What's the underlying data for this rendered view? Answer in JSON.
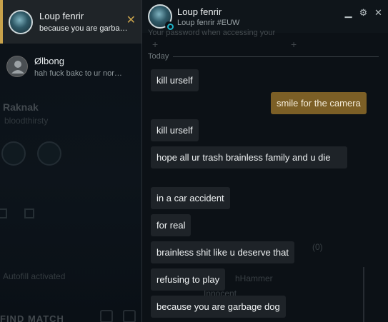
{
  "conversations": [
    {
      "name": "Loup fenrir",
      "preview": "because you are garbage dog",
      "active": true
    },
    {
      "name": "Ølbong",
      "preview": "hah fuck bakc to ur normal",
      "active": false
    }
  ],
  "background_client": {
    "summoner_name": "Raknak",
    "status": "bloodthirsty",
    "autofill_text": "Autofill activated",
    "match_button": "FIND MATCH"
  },
  "chat": {
    "friend_name": "Loup fenrir",
    "friend_tag": "Loup fenrir #EUW",
    "header_icons": [
      "minimize-icon",
      "gear-icon",
      "close-icon"
    ],
    "ghost_text": "Your password when accessing your",
    "date_divider": "Today",
    "messages": [
      {
        "direction": "in",
        "text": "kill urself"
      },
      {
        "direction": "out",
        "text": "smile for the camera"
      },
      {
        "direction": "in",
        "text": "kill urself"
      },
      {
        "direction": "in",
        "text": "hope all ur trash brainless family and u die"
      },
      {
        "direction": "in",
        "text": "in a car accident"
      },
      {
        "direction": "in",
        "text": "for real"
      },
      {
        "direction": "in",
        "text": "brainless shit like u deserve that"
      },
      {
        "direction": "in",
        "text": "refusing to play"
      },
      {
        "direction": "in",
        "text": "because you are garbage dog"
      }
    ],
    "bleed_texts": [
      "(0)",
      "hHammer",
      "Innocent"
    ]
  },
  "colors": {
    "accent_gold": "#c8a24b",
    "outgoing_bubble": "#7c5f26",
    "incoming_bubble": "#1e2328",
    "online_ring": "#1fb3c7"
  }
}
